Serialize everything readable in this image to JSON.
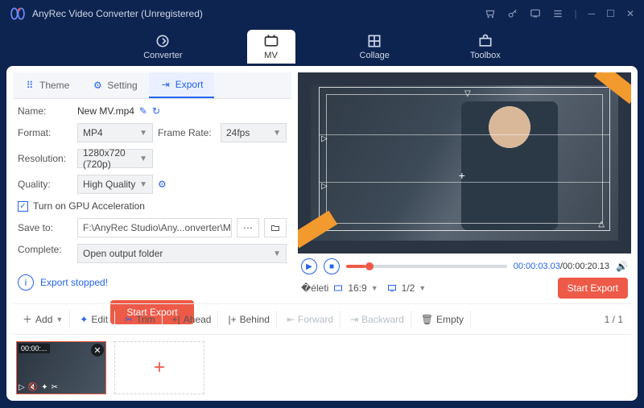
{
  "titlebar": {
    "title": "AnyRec Video Converter (Unregistered)"
  },
  "nav": {
    "converter": "Converter",
    "mv": "MV",
    "collage": "Collage",
    "toolbox": "Toolbox"
  },
  "tabs": {
    "theme": "Theme",
    "setting": "Setting",
    "export": "Export"
  },
  "form": {
    "name_label": "Name:",
    "name_value": "New MV.mp4",
    "format_label": "Format:",
    "format_value": "MP4",
    "framerate_label": "Frame Rate:",
    "framerate_value": "24fps",
    "resolution_label": "Resolution:",
    "resolution_value": "1280x720 (720p)",
    "quality_label": "Quality:",
    "quality_value": "High Quality",
    "gpu_label": "Turn on GPU Acceleration",
    "saveto_label": "Save to:",
    "saveto_value": "F:\\AnyRec Studio\\Any...onverter\\MV Exported",
    "complete_label": "Complete:",
    "complete_value": "Open output folder"
  },
  "alert": {
    "text": "Export stopped!"
  },
  "buttons": {
    "start_export": "Start Export"
  },
  "playback": {
    "current": "00:00:03.03",
    "total": "00:00:20.13",
    "aspect": "16:9",
    "index": "1/2"
  },
  "toolbar": {
    "add": "Add",
    "edit": "Edit",
    "trim": "Trim",
    "ahead": "Ahead",
    "behind": "Behind",
    "forward": "Forward",
    "backward": "Backward",
    "empty": "Empty"
  },
  "pager": {
    "current": "1",
    "total": "1"
  },
  "thumb": {
    "duration": "00:00:..."
  }
}
